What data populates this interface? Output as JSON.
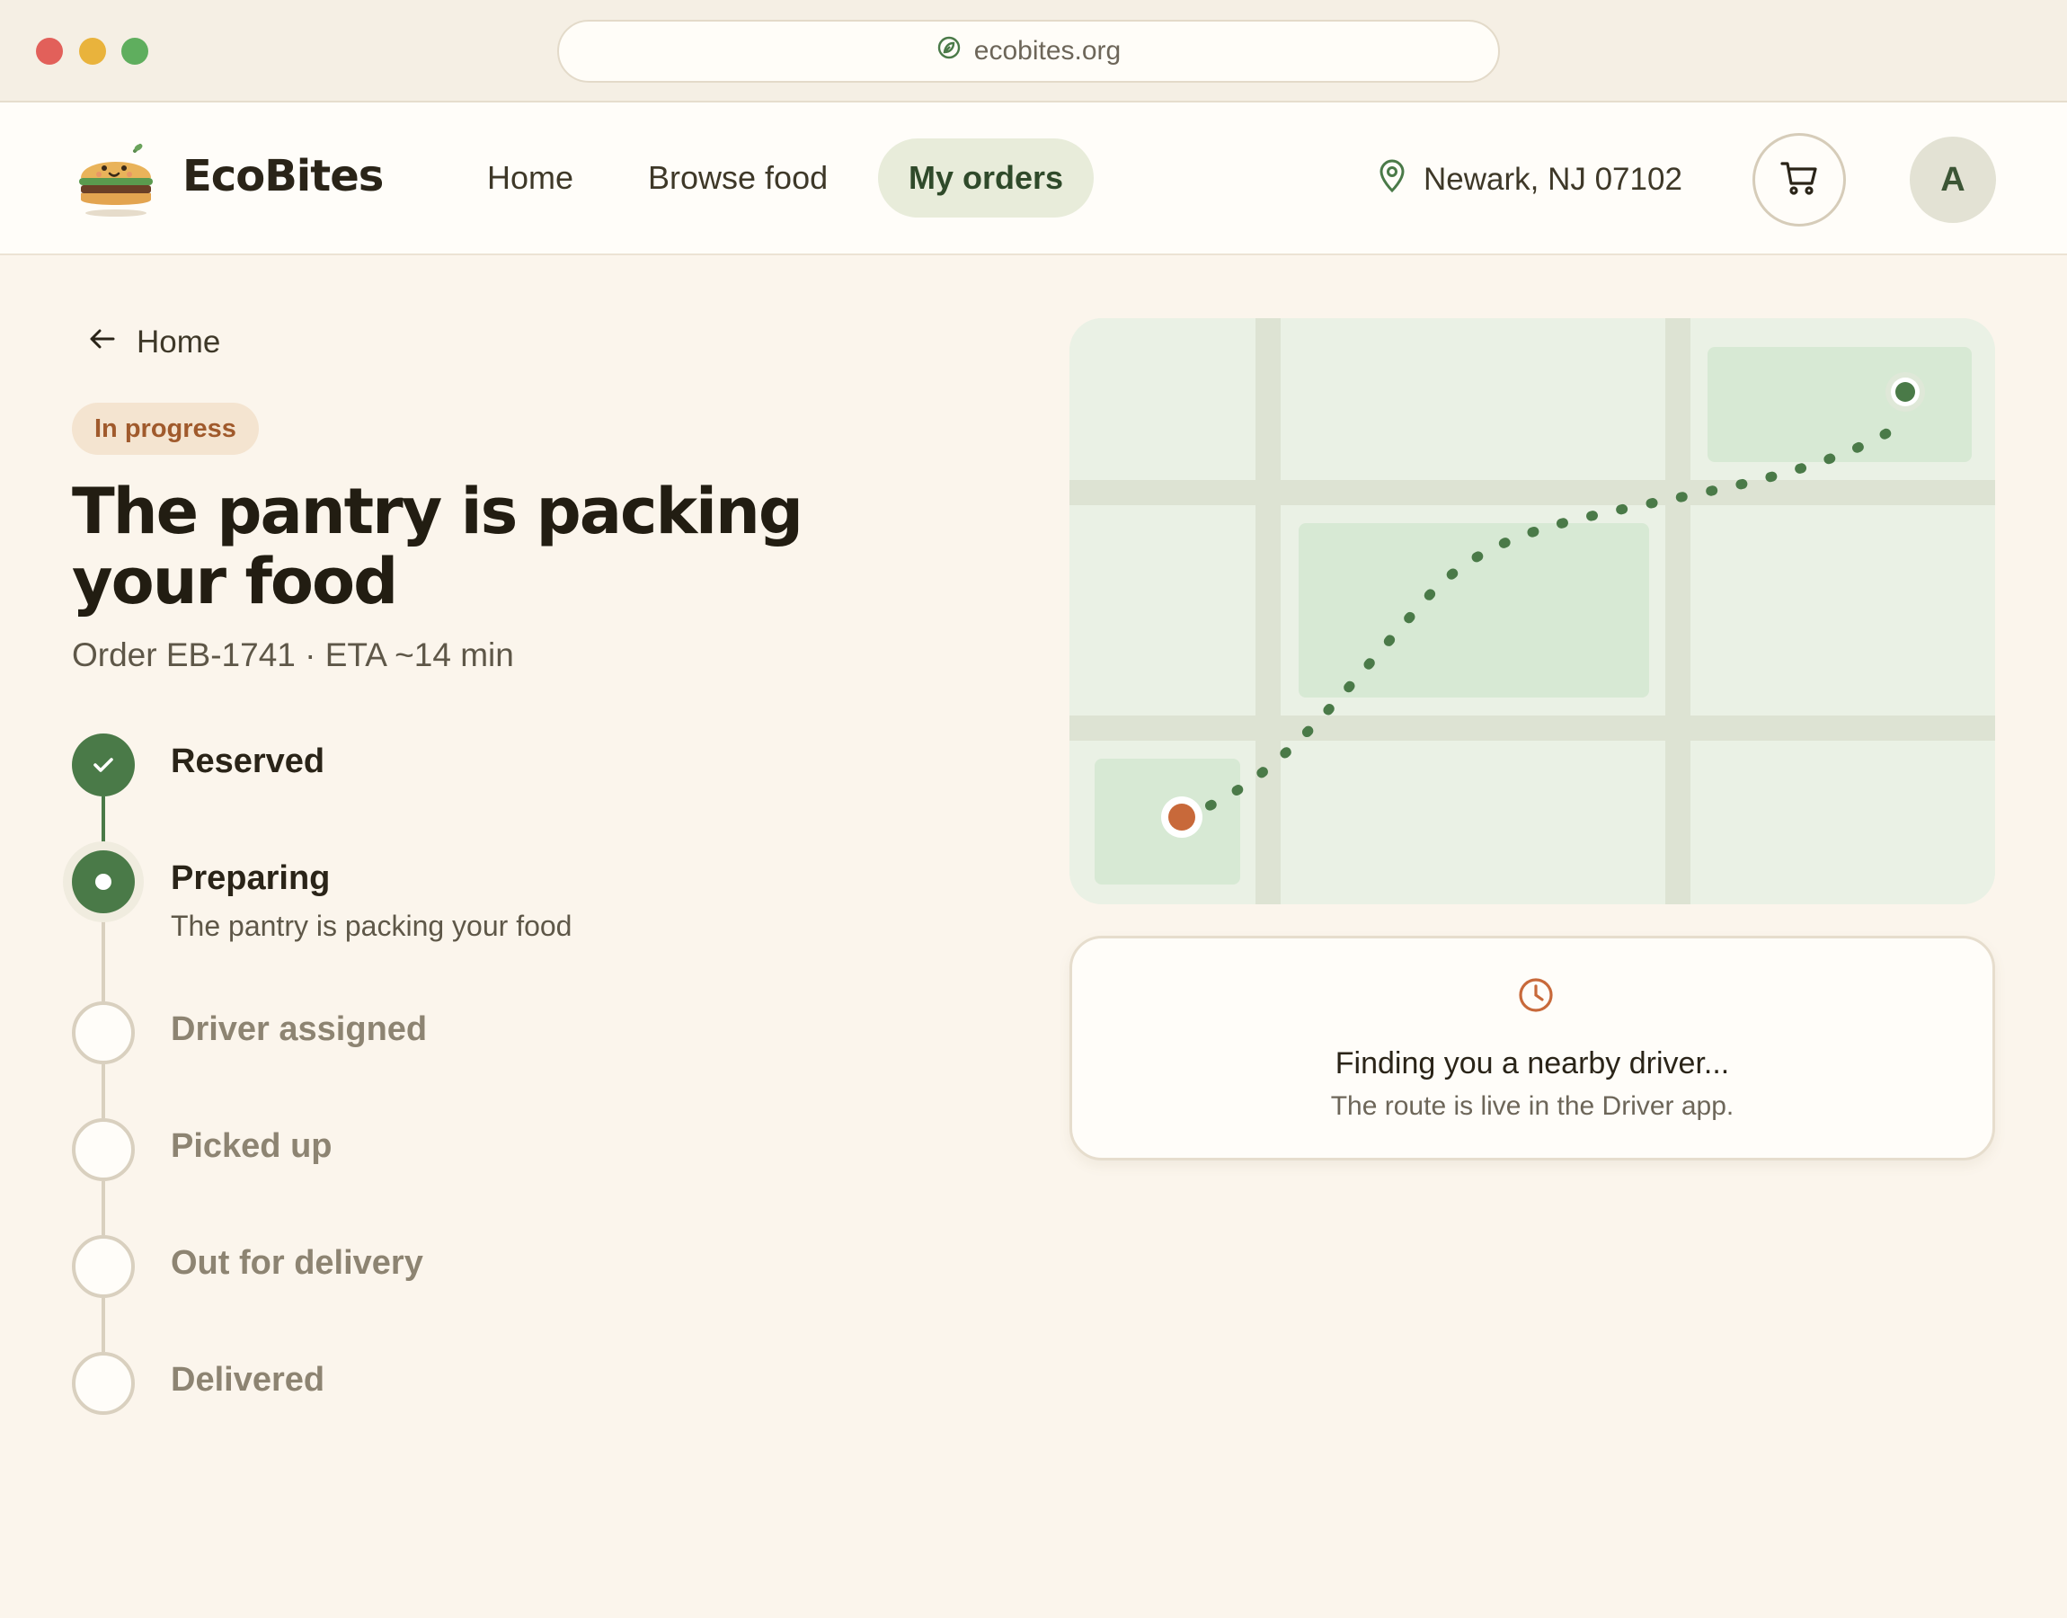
{
  "browser": {
    "url": "ecobites.org"
  },
  "brand": {
    "name": "EcoBites",
    "logo_icon": "burger-mascot-icon"
  },
  "nav": {
    "links": [
      "Home",
      "Browse food",
      "My orders"
    ],
    "active": "My orders",
    "location": "Newark, NJ 07102",
    "cart_icon": "cart-icon",
    "avatar_initial": "A"
  },
  "order": {
    "back_label": "Home",
    "status_badge": "In progress",
    "title": "The pantry is packing your food",
    "meta": "Order EB-1741 · ETA ~14 min",
    "steps": [
      {
        "label": "Reserved",
        "state": "done"
      },
      {
        "label": "Preparing",
        "state": "current",
        "detail": "The pantry is packing your food"
      },
      {
        "label": "Driver assigned",
        "state": "todo"
      },
      {
        "label": "Picked up",
        "state": "todo"
      },
      {
        "label": "Out for delivery",
        "state": "todo"
      },
      {
        "label": "Delivered",
        "state": "todo"
      }
    ]
  },
  "map": {
    "origin_color": "#c8693a",
    "destination_color": "#4a7a48",
    "route_color": "#4a7a48"
  },
  "driver_card": {
    "icon": "clock-icon",
    "title": "Finding you a nearby driver...",
    "subtitle": "The route is live in the Driver app."
  },
  "colors": {
    "accent_green": "#4a7a48",
    "accent_orange": "#c8693a",
    "background": "#fbf5ec"
  }
}
